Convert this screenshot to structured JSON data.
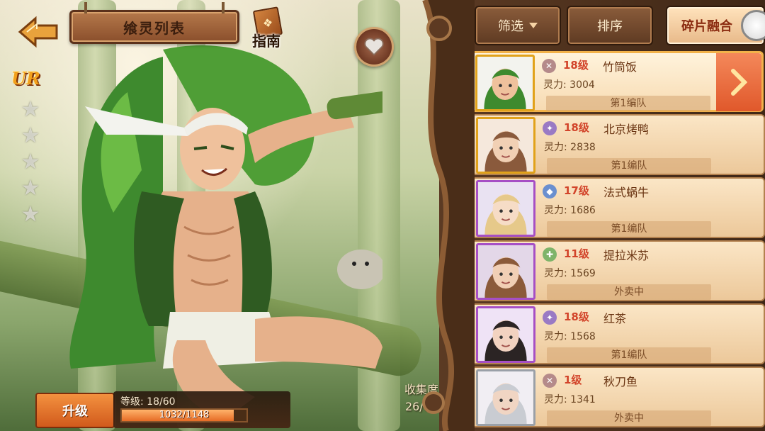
{
  "header": {
    "title": "飨灵列表",
    "guide_label": "指南"
  },
  "hero": {
    "rarity": "UR",
    "stars_total": 5
  },
  "bottom": {
    "upgrade_label": "升级",
    "level_text": "等级: 18/60",
    "exp_text": "1032/1148",
    "exp_current": 1032,
    "exp_max": 1148,
    "collection_label": "收集度",
    "collection_value": "26/62"
  },
  "toolbar": {
    "filter_label": "筛选",
    "sort_label": "排序",
    "fuse_label": "碎片融合"
  },
  "cards": [
    {
      "level": "18级",
      "name": "竹筒饭",
      "power": "灵力: 3004",
      "status": "第1编队",
      "frame": "gold",
      "element": "sword",
      "selected": true
    },
    {
      "level": "18级",
      "name": "北京烤鸭",
      "power": "灵力: 2838",
      "status": "第1编队",
      "frame": "gold",
      "element": "star",
      "selected": false
    },
    {
      "level": "17级",
      "name": "法式蜗牛",
      "power": "灵力: 1686",
      "status": "第1编队",
      "frame": "purple",
      "element": "shield",
      "selected": false
    },
    {
      "level": "11级",
      "name": "提拉米苏",
      "power": "灵力: 1569",
      "status": "外卖中",
      "frame": "purple",
      "element": "heal",
      "selected": false
    },
    {
      "level": "18级",
      "name": "红茶",
      "power": "灵力: 1568",
      "status": "第1编队",
      "frame": "purple",
      "element": "star",
      "selected": false
    },
    {
      "level": "1级",
      "name": "秋刀鱼",
      "power": "灵力: 1341",
      "status": "外卖中",
      "frame": "silver",
      "element": "sword",
      "selected": false
    }
  ],
  "colors": {
    "level_red": "#d2442a",
    "accent_orange": "#e0582b",
    "wood_dark": "#3f2716"
  }
}
